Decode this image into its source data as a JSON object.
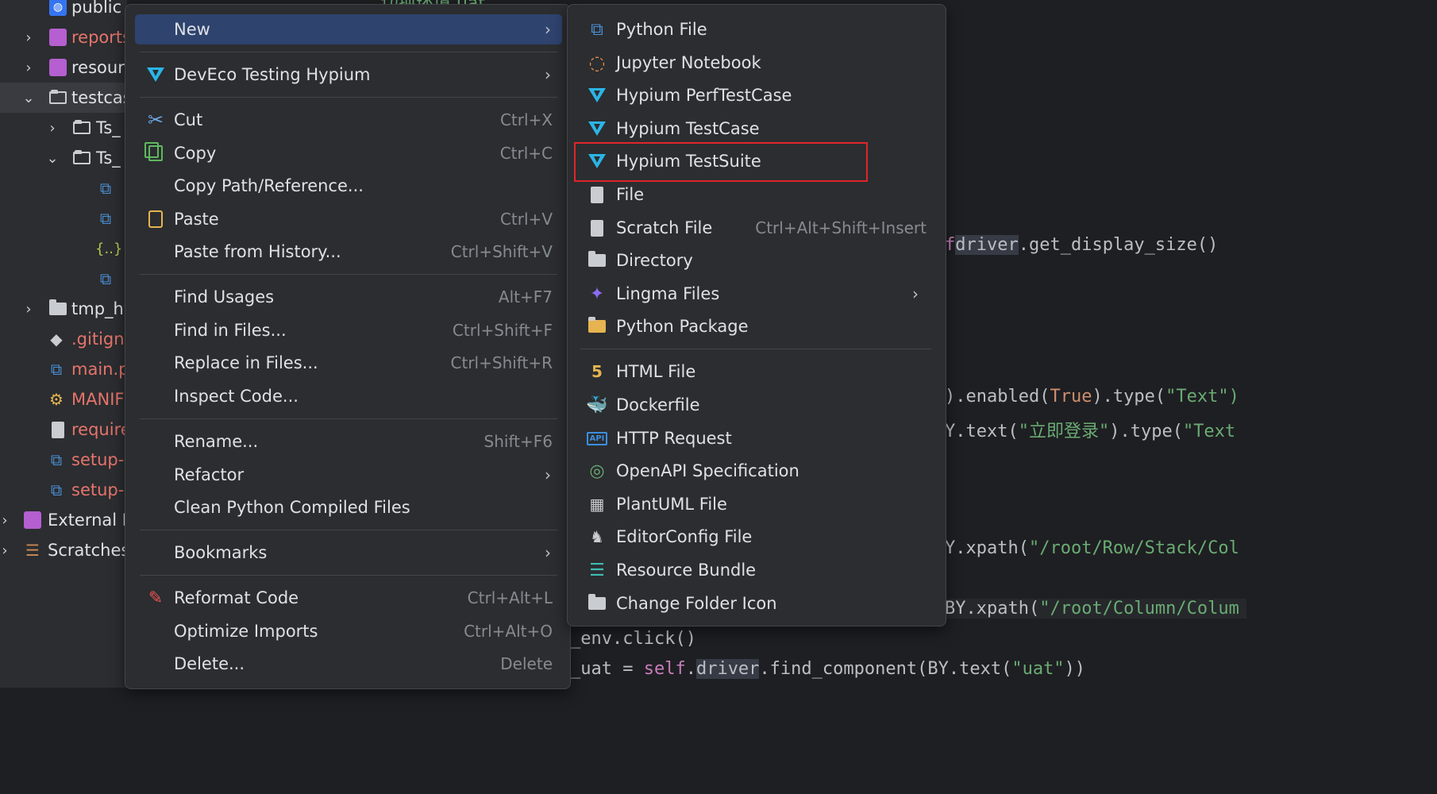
{
  "tree": {
    "items": [
      {
        "label": "public"
      },
      {
        "label": "reports"
      },
      {
        "label": "resour"
      },
      {
        "label": "testcas"
      },
      {
        "label": "Ts_"
      },
      {
        "label": "Ts_"
      },
      {
        "label": "{..}"
      },
      {
        "label": "tmp_hy"
      },
      {
        "label": ".gitign"
      },
      {
        "label": "main.p"
      },
      {
        "label": "MANIF"
      },
      {
        "label": "require"
      },
      {
        "label": "setup-"
      },
      {
        "label": "setup-"
      },
      {
        "label": "External L"
      },
      {
        "label": "Scratches"
      }
    ]
  },
  "editor": {
    "top_comment": "切换环境 uat",
    "line1": {
      "a": "f",
      ".": ".",
      "b": "driver",
      "c": ".get_display_size()"
    },
    "line2": {
      "a": ").enabled(",
      "b": "True",
      "c": ").type(",
      "d": "\"Text\")"
    },
    "line3": {
      "a": "Y.text(",
      "b": "\"立即登录\"",
      "c": ").type(",
      "d": "\"Text"
    },
    "line4": {
      "a": "Y.xpath(",
      "b": "\"/root/Row/Stack/Col"
    },
    "line5": {
      "a": "BY.xpath(",
      "b": "\"/root/Column/Colum"
    },
    "line6": {
      "a": "_env.click()"
    },
    "line7": {
      "a": "_uat = ",
      "b": "self",
      "c": ".",
      "d": "driver",
      "e": ".find_component(BY.text(",
      "f": "\"uat\"",
      "g": "))"
    }
  },
  "menu": {
    "new": "New",
    "deveco": "DevEco Testing Hypium",
    "cut": "Cut",
    "cut_sc": "Ctrl+X",
    "copy": "Copy",
    "copy_sc": "Ctrl+C",
    "copy_path": "Copy Path/Reference...",
    "paste": "Paste",
    "paste_sc": "Ctrl+V",
    "paste_history": "Paste from History...",
    "paste_history_sc": "Ctrl+Shift+V",
    "find_usages": "Find Usages",
    "find_usages_sc": "Alt+F7",
    "find_in_files": "Find in Files...",
    "find_in_files_sc": "Ctrl+Shift+F",
    "replace_in_files": "Replace in Files...",
    "replace_in_files_sc": "Ctrl+Shift+R",
    "inspect": "Inspect Code...",
    "rename": "Rename...",
    "rename_sc": "Shift+F6",
    "refactor": "Refactor",
    "clean": "Clean Python Compiled Files",
    "bookmarks": "Bookmarks",
    "reformat": "Reformat Code",
    "reformat_sc": "Ctrl+Alt+L",
    "optimize": "Optimize Imports",
    "optimize_sc": "Ctrl+Alt+O",
    "delete": "Delete...",
    "delete_sc": "Delete"
  },
  "submenu": {
    "python_file": "Python File",
    "jupyter": "Jupyter Notebook",
    "perf": "Hypium PerfTestCase",
    "testcase": "Hypium TestCase",
    "testsuite": "Hypium TestSuite",
    "file": "File",
    "scratch": "Scratch File",
    "scratch_sc": "Ctrl+Alt+Shift+Insert",
    "directory": "Directory",
    "lingma": "Lingma Files",
    "python_package": "Python Package",
    "html": "HTML File",
    "dockerfile": "Dockerfile",
    "http": "HTTP Request",
    "openapi": "OpenAPI Specification",
    "plantuml": "PlantUML File",
    "editorconfig": "EditorConfig File",
    "resource_bundle": "Resource Bundle",
    "change_folder_icon": "Change Folder Icon",
    "api_badge": "API"
  }
}
